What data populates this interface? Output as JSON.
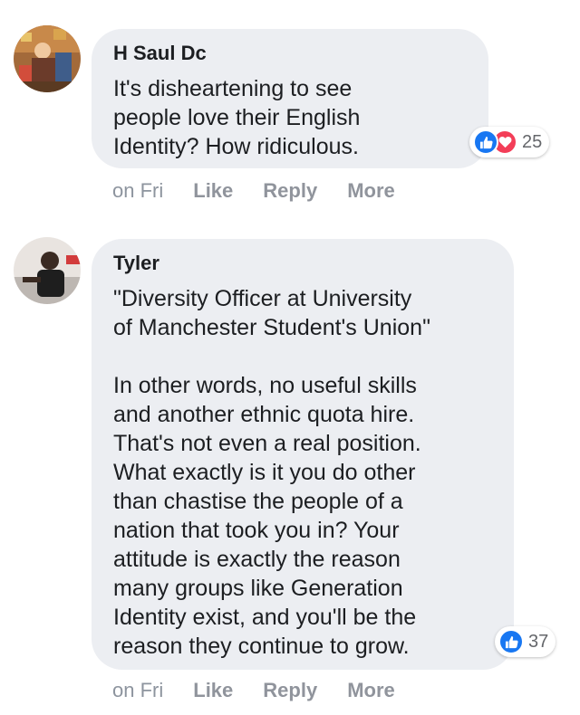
{
  "comments": [
    {
      "author": "H Saul Dc",
      "text": "It's disheartening to see\npeople love their English\nIdentity? How ridiculous.",
      "reactions": {
        "types": [
          "like-icon",
          "love-icon"
        ],
        "count": "25"
      },
      "actions": {
        "time": "on Fri",
        "like": "Like",
        "reply": "Reply",
        "more": "More"
      }
    },
    {
      "author": "Tyler",
      "text": "\"Diversity Officer at University\nof Manchester Student's Union\"\n\nIn other words, no useful skills\nand another ethnic quota hire.\nThat's not even a real position.\nWhat exactly is it you do other\nthan chastise the people of a\nnation that took you in? Your\nattitude is exactly the reason\nmany groups like Generation\nIdentity exist, and you'll be the\nreason they continue to grow.",
      "reactions": {
        "types": [
          "like-icon"
        ],
        "count": "37"
      },
      "actions": {
        "time": "on Fri",
        "like": "Like",
        "reply": "Reply",
        "more": "More"
      }
    }
  ],
  "colors": {
    "bubble": "#eceef2",
    "like_blue": "#1877f2",
    "love_red": "#f33e58",
    "meta_gray": "#90949c"
  }
}
